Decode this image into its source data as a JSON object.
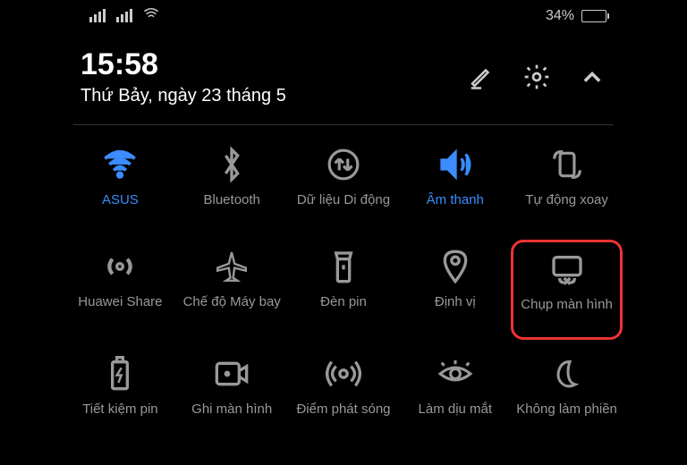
{
  "statusBar": {
    "batteryText": "34%",
    "batteryLevel": 34
  },
  "header": {
    "time": "15:58",
    "date": "Thứ Bảy, ngày 23 tháng 5"
  },
  "toggles": [
    {
      "id": "wifi",
      "label": "ASUS",
      "active": true,
      "highlighted": false
    },
    {
      "id": "bluetooth",
      "label": "Bluetooth",
      "active": false,
      "highlighted": false
    },
    {
      "id": "mobiledata",
      "label": "Dữ liệu Di động",
      "active": false,
      "highlighted": false
    },
    {
      "id": "sound",
      "label": "Âm thanh",
      "active": true,
      "highlighted": false
    },
    {
      "id": "autorotate",
      "label": "Tự động xoay",
      "active": false,
      "highlighted": false
    },
    {
      "id": "huaweishare",
      "label": "Huawei Share",
      "active": false,
      "highlighted": false
    },
    {
      "id": "airplane",
      "label": "Chế độ Máy bay",
      "active": false,
      "highlighted": false
    },
    {
      "id": "flashlight",
      "label": "Đèn pin",
      "active": false,
      "highlighted": false
    },
    {
      "id": "location",
      "label": "Định vị",
      "active": false,
      "highlighted": false
    },
    {
      "id": "screenshot",
      "label": "Chụp màn hình",
      "active": false,
      "highlighted": true
    },
    {
      "id": "battery",
      "label": "Tiết kiệm pin",
      "active": false,
      "highlighted": false
    },
    {
      "id": "screenrecord",
      "label": "Ghi màn hình",
      "active": false,
      "highlighted": false
    },
    {
      "id": "hotspot",
      "label": "Điểm phát sóng",
      "active": false,
      "highlighted": false
    },
    {
      "id": "eyecomfort",
      "label": "Làm dịu mắt",
      "active": false,
      "highlighted": false
    },
    {
      "id": "dnd",
      "label": "Không làm phiền",
      "active": false,
      "highlighted": false
    }
  ]
}
